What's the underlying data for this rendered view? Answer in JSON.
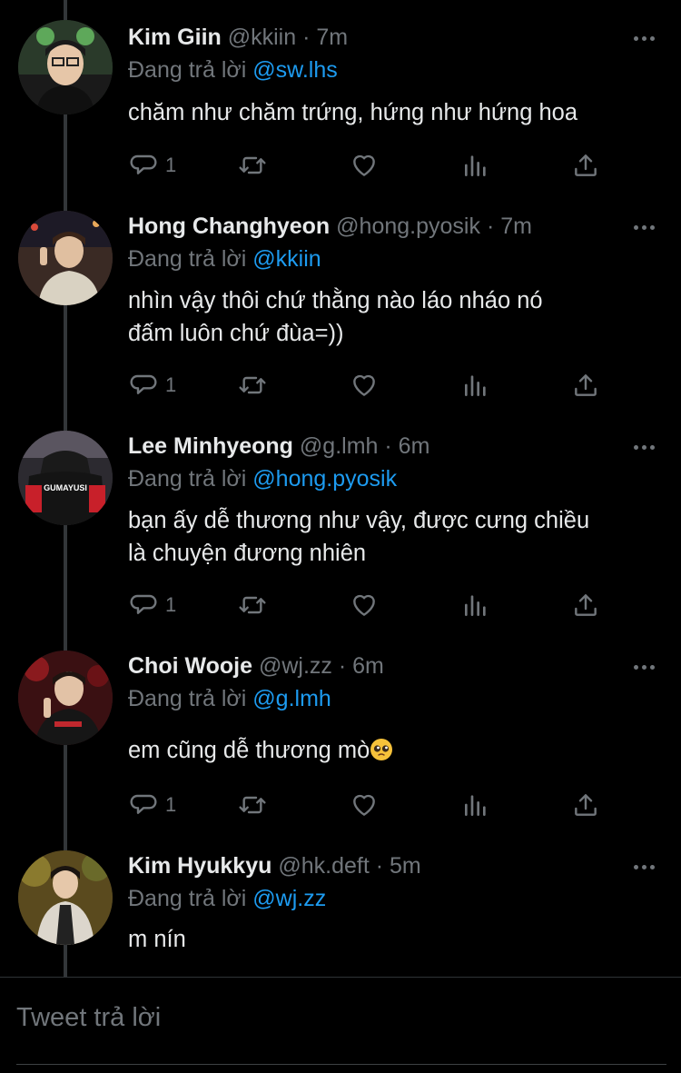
{
  "tweets": [
    {
      "name": "Kim Giin",
      "handle": "@kkiin",
      "time": "· 7m",
      "replying_label": "Đang trả lời",
      "replying_to": "@sw.lhs",
      "text": "chăm như chăm trứng, hứng như hứng hoa",
      "reply_count": "1"
    },
    {
      "name": "Hong Changhyeon",
      "handle": "@hong.pyosik",
      "time": "· 7m",
      "replying_label": "Đang trả lời",
      "replying_to": "@kkiin",
      "text_line1": "nhìn vậy thôi chứ thằng nào láo nháo nó",
      "text_line2": "đấm luôn chứ đùa=))",
      "reply_count": "1"
    },
    {
      "name": "Lee Minhyeong",
      "handle": "@g.lmh",
      "time": "· 6m",
      "replying_label": "Đang trả lời",
      "replying_to": "@hong.pyosik",
      "text_line1": "bạn ấy dễ thương như vậy, được cưng chiều",
      "text_line2": "là chuyện đương nhiên",
      "reply_count": "1",
      "jersey_text": "GUMAYUSI"
    },
    {
      "name": "Choi Wooje",
      "handle": "@wj.zz",
      "time": "· 6m",
      "replying_label": "Đang trả lời",
      "replying_to": "@g.lmh",
      "text": "em cũng dễ thương mò",
      "reply_count": "1"
    },
    {
      "name": "Kim Hyukkyu",
      "handle": "@hk.deft",
      "time": "· 5m",
      "replying_label": "Đang trả lời",
      "replying_to": "@wj.zz",
      "text": "m nín"
    }
  ],
  "compose": {
    "placeholder": "Tweet trả lời"
  },
  "icons": {
    "reply": "reply-icon",
    "retweet": "retweet-icon",
    "like": "heart-icon",
    "views": "analytics-icon",
    "share": "share-icon",
    "more": "more-options-icon",
    "emoji": "pleading-face-emoji"
  },
  "colors": {
    "background": "#000000",
    "text": "#e7e9ea",
    "secondary": "#71767b",
    "link": "#1d9bf0",
    "thread_line": "#333639"
  }
}
